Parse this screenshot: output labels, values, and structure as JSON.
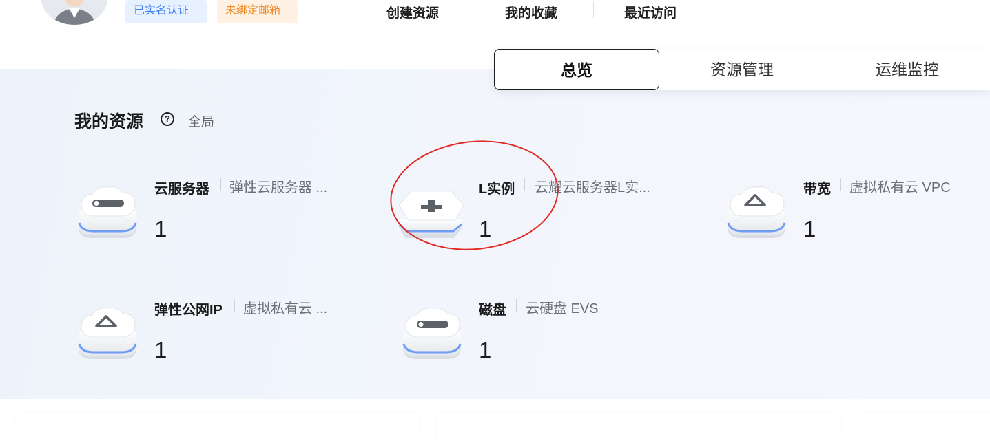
{
  "header": {
    "badges": {
      "verified": "已实名认证",
      "email_unbound": "未绑定邮箱"
    },
    "quick_links": [
      "创建资源",
      "我的收藏",
      "最近访问"
    ]
  },
  "tabs": [
    "总览",
    "资源管理",
    "运维监控"
  ],
  "active_tab": "总览",
  "resources": {
    "title": "我的资源",
    "help_icon": "question-circle-icon",
    "scope": "全局",
    "items": [
      {
        "name": "云服务器",
        "desc": "弹性云服务器 ...",
        "count": "1",
        "icon": "cloud-server-icon"
      },
      {
        "name": "L实例",
        "desc": "云耀云服务器L实...",
        "count": "1",
        "icon": "l-instance-icon"
      },
      {
        "name": "带宽",
        "desc": "虚拟私有云 VPC",
        "count": "1",
        "icon": "bandwidth-icon"
      },
      {
        "name": "弹性公网IP",
        "desc": "虚拟私有云 ...",
        "count": "1",
        "icon": "eip-icon"
      },
      {
        "name": "磁盘",
        "desc": "云硬盘 EVS",
        "count": "1",
        "icon": "disk-icon"
      }
    ]
  },
  "colors": {
    "badge_verified_text": "#3d7ff1",
    "badge_unbound_text": "#f08a24",
    "annotation_circle": "#e02a23",
    "icon_accent": "#6f9cf5"
  }
}
